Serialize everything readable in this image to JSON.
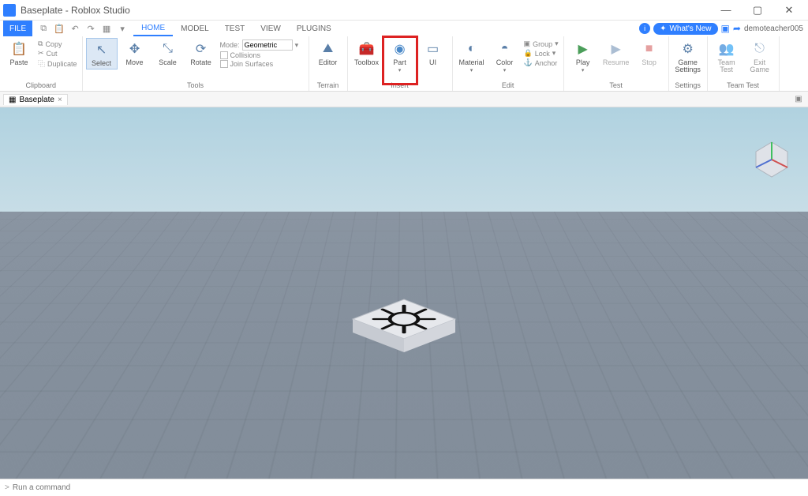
{
  "window": {
    "title": "Baseplate - Roblox Studio",
    "min": "—",
    "max": "▢",
    "close": "✕"
  },
  "menu": {
    "file": "FILE",
    "tabs": [
      "HOME",
      "MODEL",
      "TEST",
      "VIEW",
      "PLUGINS"
    ],
    "active_tab": 0,
    "whats_new": "What's New",
    "username": "demoteacher005"
  },
  "ribbon": {
    "clipboard": {
      "paste": "Paste",
      "copy": "Copy",
      "cut": "Cut",
      "duplicate": "Duplicate",
      "label": "Clipboard"
    },
    "tools": {
      "select": "Select",
      "move": "Move",
      "scale": "Scale",
      "rotate": "Rotate",
      "mode_label": "Mode:",
      "mode_value": "Geometric",
      "collisions": "Collisions",
      "join": "Join Surfaces",
      "label": "Tools"
    },
    "terrain": {
      "editor": "Editor",
      "label": "Terrain"
    },
    "insert": {
      "toolbox": "Toolbox",
      "part": "Part",
      "ui": "UI",
      "label": "Insert"
    },
    "edit": {
      "material": "Material",
      "color": "Color",
      "group": "Group",
      "lock": "Lock",
      "anchor": "Anchor",
      "label": "Edit"
    },
    "test": {
      "play": "Play",
      "resume": "Resume",
      "stop": "Stop",
      "label": "Test"
    },
    "settings": {
      "game": "Game\nSettings",
      "label": "Settings"
    },
    "teamtest": {
      "team": "Team\nTest",
      "exit": "Exit\nGame",
      "label": "Team Test"
    }
  },
  "doc_tab": {
    "icon": "▦",
    "name": "Baseplate",
    "close": "×"
  },
  "cmd": {
    "prompt": ">",
    "placeholder": "Run a command"
  }
}
